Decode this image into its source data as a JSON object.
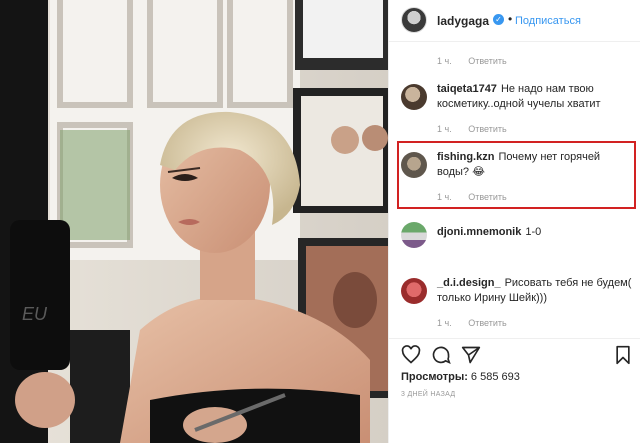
{
  "header": {
    "username": "ladygaga",
    "verified_icon": "verified-check-icon",
    "separator": "•",
    "follow_label": "Подписаться"
  },
  "comments": [
    {
      "type": "meta",
      "time": "1 ч.",
      "reply": "Ответить"
    },
    {
      "username": "taiqeta1747",
      "text": "Не надо нам твою косметику..одной чучелы хватит",
      "time": "1 ч.",
      "reply": "Ответить"
    },
    {
      "username": "fishing.kzn",
      "text": "Почему нет горячей воды? 😂",
      "time": "1 ч.",
      "reply": "Ответить"
    },
    {
      "username": "djoni.mnemonik",
      "text": "1-0"
    },
    {
      "username": "_d.i.design_",
      "text": "Рисовать тебя не будем( только Ирину Шейк)))",
      "time": "1 ч.",
      "reply": "Ответить"
    }
  ],
  "actions": {
    "like_icon": "heart-icon",
    "comment_icon": "comment-bubble-icon",
    "share_icon": "share-plane-icon",
    "save_icon": "bookmark-icon",
    "views_label": "Просмотры:",
    "views_count": "6 585 693",
    "posted_ago": "3 ДНЕЙ НАЗАД"
  },
  "colors": {
    "accent": "#3897f0",
    "highlight_border": "#d22222",
    "meta_text": "#999999"
  }
}
